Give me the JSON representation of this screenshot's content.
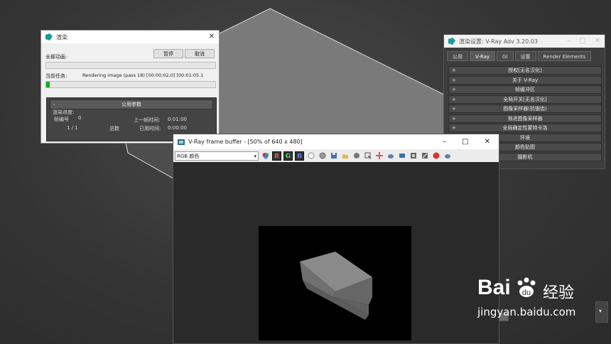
{
  "render_dialog": {
    "title": "渲染",
    "all_animation_label": "全部动画:",
    "pause_button": "暂停",
    "cancel_button": "取消",
    "current_task_label": "当前任务:",
    "current_task_value": "Rendering image (pass 18) [00:00:02.0] [00:01:05.1",
    "task_progress": 0.02,
    "common_params_title": "公用参数",
    "render_progress_label": "渲染进度:",
    "frame_number_label": "帧编号",
    "frame_number_value": "0",
    "prev_frame_time_label": "上一帧时间:",
    "prev_frame_time_value": "0:01:00",
    "frames_value": "1 / 1",
    "total_label": "总数",
    "elapsed_label": "已用时间:",
    "elapsed_value": "0:00:00"
  },
  "render_settings": {
    "title": "渲染设置: V-Ray Adv 3.20.03",
    "tabs": [
      "公用",
      "V-Ray",
      "GI",
      "设置",
      "Render Elements"
    ],
    "active_tab": "V-Ray",
    "rollouts": [
      "授权[无名汉化]",
      "关于 V-Ray",
      "帧缓冲区",
      "全局开关[无名汉化]",
      "图像采样器(抗锯齿)",
      "渐进图像采样器",
      "全局确定性蒙特卡洛",
      "环境",
      "颜色贴图",
      "摄影机"
    ]
  },
  "frame_buffer": {
    "title": "V-Ray frame buffer - [50% of 640 x 480]",
    "channel_select": "RGB 颜色",
    "channel_buttons": [
      "R",
      "G",
      "B"
    ]
  },
  "watermark": {
    "brand": "Bai",
    "brand_suffix": "经验",
    "url": "jingyan.baidu.com"
  },
  "colors": {
    "progress_green": "#06b025",
    "red_channel": "#ff5a5a",
    "green_channel": "#5aff5a",
    "blue_channel": "#6a8cff"
  }
}
